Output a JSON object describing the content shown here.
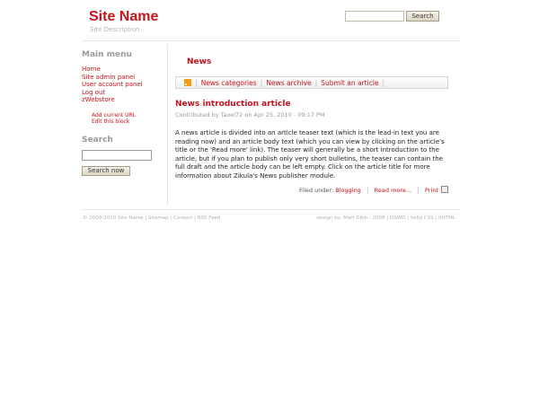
{
  "header": {
    "site_name": "Site Name",
    "site_description": "Site Description",
    "search_button": "Search"
  },
  "sidebar": {
    "main_menu_title": "Main menu",
    "menu_items": [
      "Home",
      "Site admin panel",
      "User account panel",
      "Log out",
      "zWebstore"
    ],
    "block_links": [
      "Add current URL",
      "Edit this block"
    ],
    "search_title": "Search",
    "search_button": "Search now"
  },
  "main": {
    "title": "News",
    "nav": [
      "News categories",
      "News archive",
      "Submit an article"
    ],
    "article": {
      "title": "News introduction article",
      "meta": "Contributed by Taxel72 on Apr 25, 2010 - 09:17 PM",
      "body": "A news article is divided into an article teaser text (which is the lead-in text you are reading now) and an article body text (which you can view by clicking on the article's title or the 'Read more' link). The teaser will generally be a short introduction to the article, but if you plan to publish only very short bulletins, the teaser can contain the full draft and the article body can be left empty. Click on the article title for more information about Zikula's News publisher module.",
      "filed_under": "Filed under:",
      "category": "Blogging",
      "read_more": "Read more...",
      "print": "Print"
    }
  },
  "footer": {
    "left": "© 2009-2010 Site Name | Sitemap | Contact | RSS Feed",
    "right": "design by: Matt Dibb - 2008 | OSWD | Valid CSS | XHTML"
  }
}
